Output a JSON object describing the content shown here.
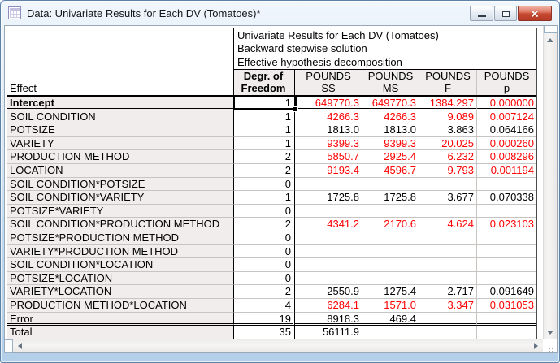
{
  "window": {
    "title": "Data: Univariate Results for Each DV (Tomatoes)*",
    "buttons": {
      "minimize": "minimize",
      "restore": "restore",
      "close": "close"
    }
  },
  "table": {
    "info_lines": [
      "Univariate Results for Each DV (Tomatoes)",
      "Backward stepwise solution",
      "Effective hypothesis decomposition"
    ],
    "effect_header": "Effect",
    "columns": [
      {
        "line1": "Degr. of",
        "line2": "Freedom"
      },
      {
        "line1": "POUNDS",
        "line2": "SS"
      },
      {
        "line1": "POUNDS",
        "line2": "MS"
      },
      {
        "line1": "POUNDS",
        "line2": "F"
      },
      {
        "line1": "POUNDS",
        "line2": "p"
      }
    ],
    "rows": [
      {
        "label": "Intercept",
        "bold": true,
        "selected": true,
        "double_bottom": true,
        "significant": true,
        "values": [
          "1",
          "649770.3",
          "649770.3",
          "1384.297",
          "0.000000"
        ]
      },
      {
        "label": "SOIL CONDITION",
        "significant": true,
        "values": [
          "1",
          "4266.3",
          "4266.3",
          "9.089",
          "0.007124"
        ]
      },
      {
        "label": "POTSIZE",
        "significant": false,
        "values": [
          "1",
          "1813.0",
          "1813.0",
          "3.863",
          "0.064166"
        ]
      },
      {
        "label": "VARIETY",
        "significant": true,
        "values": [
          "1",
          "9399.3",
          "9399.3",
          "20.025",
          "0.000260"
        ]
      },
      {
        "label": "PRODUCTION METHOD",
        "significant": true,
        "values": [
          "2",
          "5850.7",
          "2925.4",
          "6.232",
          "0.008296"
        ]
      },
      {
        "label": "LOCATION",
        "significant": true,
        "values": [
          "2",
          "9193.4",
          "4596.7",
          "9.793",
          "0.001194"
        ]
      },
      {
        "label": "SOIL CONDITION*POTSIZE",
        "significant": false,
        "values": [
          "0",
          "",
          "",
          "",
          ""
        ]
      },
      {
        "label": "SOIL CONDITION*VARIETY",
        "significant": false,
        "values": [
          "1",
          "1725.8",
          "1725.8",
          "3.677",
          "0.070338"
        ]
      },
      {
        "label": "POTSIZE*VARIETY",
        "significant": false,
        "values": [
          "0",
          "",
          "",
          "",
          ""
        ]
      },
      {
        "label": "SOIL CONDITION*PRODUCTION METHOD",
        "significant": true,
        "values": [
          "2",
          "4341.2",
          "2170.6",
          "4.624",
          "0.023103"
        ]
      },
      {
        "label": "POTSIZE*PRODUCTION METHOD",
        "significant": false,
        "values": [
          "0",
          "",
          "",
          "",
          ""
        ]
      },
      {
        "label": "VARIETY*PRODUCTION METHOD",
        "significant": false,
        "values": [
          "0",
          "",
          "",
          "",
          ""
        ]
      },
      {
        "label": "SOIL CONDITION*LOCATION",
        "significant": false,
        "values": [
          "0",
          "",
          "",
          "",
          ""
        ]
      },
      {
        "label": "POTSIZE*LOCATION",
        "significant": false,
        "values": [
          "0",
          "",
          "",
          "",
          ""
        ]
      },
      {
        "label": "VARIETY*LOCATION",
        "significant": false,
        "values": [
          "2",
          "2550.9",
          "1275.4",
          "2.717",
          "0.091649"
        ]
      },
      {
        "label": "PRODUCTION METHOD*LOCATION",
        "significant": true,
        "values": [
          "4",
          "6284.1",
          "1571.0",
          "3.347",
          "0.031053"
        ]
      },
      {
        "label": "Error",
        "double_bottom": true,
        "significant": false,
        "values": [
          "19",
          "8918.3",
          "469.4",
          "",
          ""
        ]
      },
      {
        "label": "Total",
        "significant": false,
        "values": [
          "35",
          "56111.9",
          "",
          "",
          ""
        ]
      }
    ]
  },
  "colors": {
    "significant_text": "#ff0000",
    "row_label_bg": "#f1edec",
    "selection_border": "#000000",
    "close_button": "#c64730"
  }
}
